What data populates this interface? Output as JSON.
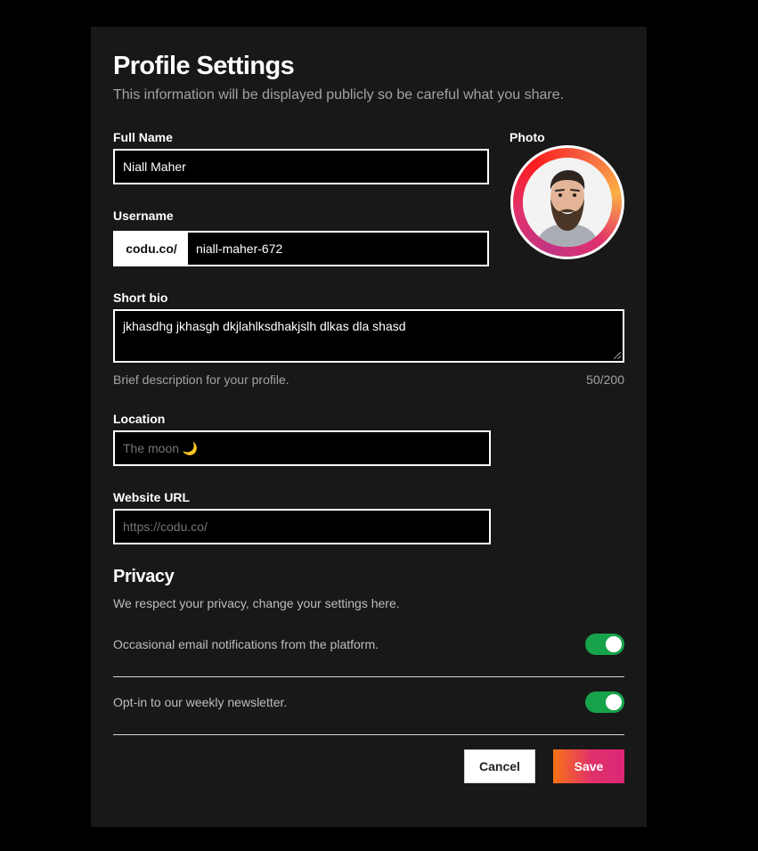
{
  "header": {
    "title": "Profile Settings",
    "subtitle": "This information will be displayed publicly so be careful what you share."
  },
  "full_name": {
    "label": "Full Name",
    "value": "Niall Maher"
  },
  "photo": {
    "label": "Photo"
  },
  "username": {
    "label": "Username",
    "prefix": "codu.co/",
    "value": "niall-maher-672"
  },
  "bio": {
    "label": "Short bio",
    "value": "jkhasdhg jkhasgh dkjlahlksdhakjslh dlkas dla shasd",
    "hint": "Brief description for your profile.",
    "counter": "50/200"
  },
  "location": {
    "label": "Location",
    "placeholder": "The moon 🌙"
  },
  "website": {
    "label": "Website URL",
    "placeholder": "https://codu.co/"
  },
  "privacy": {
    "title": "Privacy",
    "subtitle": "We respect your privacy, change your settings here.",
    "settings": [
      {
        "label": "Occasional email notifications from the platform.",
        "enabled": true
      },
      {
        "label": "Opt-in to our weekly newsletter.",
        "enabled": true
      }
    ]
  },
  "actions": {
    "cancel_label": "Cancel",
    "save_label": "Save"
  },
  "colors": {
    "panel_bg": "#181818",
    "page_bg": "#000000",
    "toggle_on": "#16a34a",
    "accent_gradient_start": "#f97316",
    "accent_gradient_end": "#db2777"
  }
}
